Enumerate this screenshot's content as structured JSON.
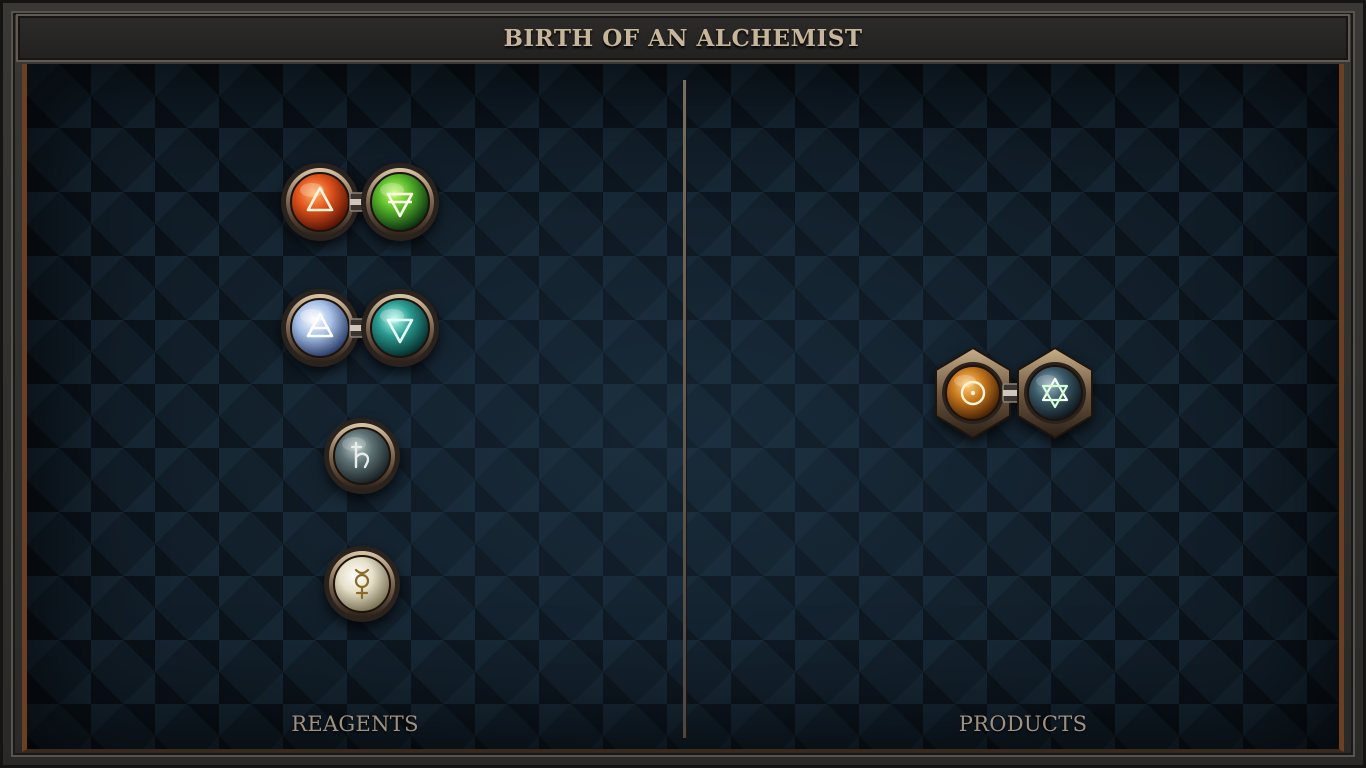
{
  "title": "BIRTH OF AN ALCHEMIST",
  "columns": {
    "left_label": "REAGENTS",
    "right_label": "PRODUCTS"
  },
  "reagents": [
    {
      "type": "pair",
      "icons": [
        "fire-symbol-icon",
        "earth-symbol-icon"
      ],
      "colors": [
        "#e0531c",
        "#55b52a"
      ]
    },
    {
      "type": "pair",
      "icons": [
        "air-symbol-icon",
        "water-symbol-icon"
      ],
      "colors": [
        "#a9c2e8",
        "#2a9a90"
      ]
    },
    {
      "type": "single",
      "icon": "saturn-lead-icon",
      "color": "#5b6f73"
    },
    {
      "type": "single",
      "icon": "mercury-icon",
      "color": "#e6e0c8"
    }
  ],
  "products": [
    {
      "type": "pair",
      "icons": [
        "sun-gold-icon",
        "hexagram-icon"
      ],
      "colors": [
        "#c8781e",
        "#3d5b6a"
      ]
    }
  ]
}
